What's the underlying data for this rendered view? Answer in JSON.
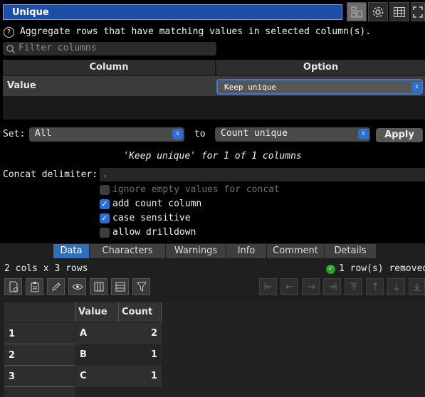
{
  "header": {
    "title": "Unique"
  },
  "toolbar_icons": [
    "dedupe-icon",
    "gear-icon",
    "table-icon",
    "expand-icon"
  ],
  "description": "Aggregate rows that have matching values in selected column(s).",
  "filter": {
    "placeholder": "Filter columns"
  },
  "column_table": {
    "headers": [
      "Column",
      "Option"
    ],
    "rows": [
      {
        "column": "Value",
        "option": "Keep unique"
      }
    ]
  },
  "set_row": {
    "set_label": "Set:",
    "set_value": "All",
    "to_label": "to",
    "to_value": "Count unique",
    "apply_label": "Apply"
  },
  "summary": "'Keep unique' for 1 of 1 columns",
  "concat": {
    "label": "Concat delimiter:",
    "value": ","
  },
  "options": [
    {
      "label": "ignore empty values for concat",
      "checked": false,
      "disabled": true
    },
    {
      "label": "add count column",
      "checked": true,
      "disabled": false
    },
    {
      "label": "case sensitive",
      "checked": true,
      "disabled": false
    },
    {
      "label": "allow drilldown",
      "checked": false,
      "disabled": false
    }
  ],
  "tabs": [
    "Data",
    "Characters",
    "Warnings",
    "Info",
    "Comment",
    "Details"
  ],
  "active_tab": "Data",
  "status": {
    "dims": "2 cols x 3 rows",
    "removed": "1 row(s) removed"
  },
  "grid": {
    "columns": [
      "Value",
      "Count"
    ],
    "rows": [
      {
        "index": "1",
        "value": "A",
        "count": "2"
      },
      {
        "index": "2",
        "value": "B",
        "count": "1"
      },
      {
        "index": "3",
        "value": "C",
        "count": "1"
      }
    ]
  },
  "colors": {
    "accent": "#2b6fd6",
    "title_bg": "#1d4fa6",
    "ok": "#2aa52a"
  }
}
